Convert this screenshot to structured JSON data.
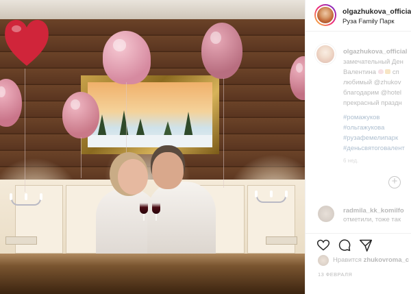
{
  "post": {
    "username": "olgazhukova_official",
    "location": "Руза Family Парк"
  },
  "caption": {
    "username": "olgazhukova_official",
    "lines": [
      "замечательный Ден",
      "Валентина",
      "любимый @zhukov",
      "благодарим @hotel",
      "прекрасный праздн"
    ],
    "line2_suffix": "сп",
    "tags": [
      "#ромажуков",
      "#ольгажукова",
      "#рузафемелипарк",
      "#деньсвятоговалент"
    ],
    "time": "6 нед."
  },
  "add_comment_symbol": "+",
  "comment": {
    "username": "radmila_kk_komilfo",
    "text_line1": "отметили, тоже так"
  },
  "likes": {
    "prefix": "Нравится",
    "username": "zhukovroma_c"
  },
  "date": "13 ФЕВРАЛЯ",
  "colors": {
    "link": "#00376b",
    "text": "#262626",
    "muted": "#8e8e8e",
    "balloon_pink": "#d98a9e",
    "balloon_red": "#d0253a"
  }
}
